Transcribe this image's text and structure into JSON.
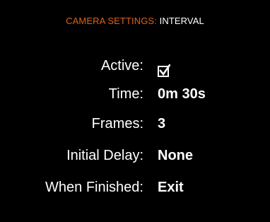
{
  "header": {
    "section": "CAMERA SETTINGS:",
    "page": "INTERVAL"
  },
  "settings": {
    "active": {
      "label": "Active:",
      "checked": true
    },
    "time": {
      "label": "Time:",
      "value": "0m 30s"
    },
    "frames": {
      "label": "Frames:",
      "value": "3"
    },
    "initial_delay": {
      "label": "Initial Delay:",
      "value": "None"
    },
    "when_finished": {
      "label": "When Finished:",
      "value": "Exit"
    }
  },
  "colors": {
    "background": "#000000",
    "accent": "#e0601a",
    "text": "#ffffff"
  }
}
